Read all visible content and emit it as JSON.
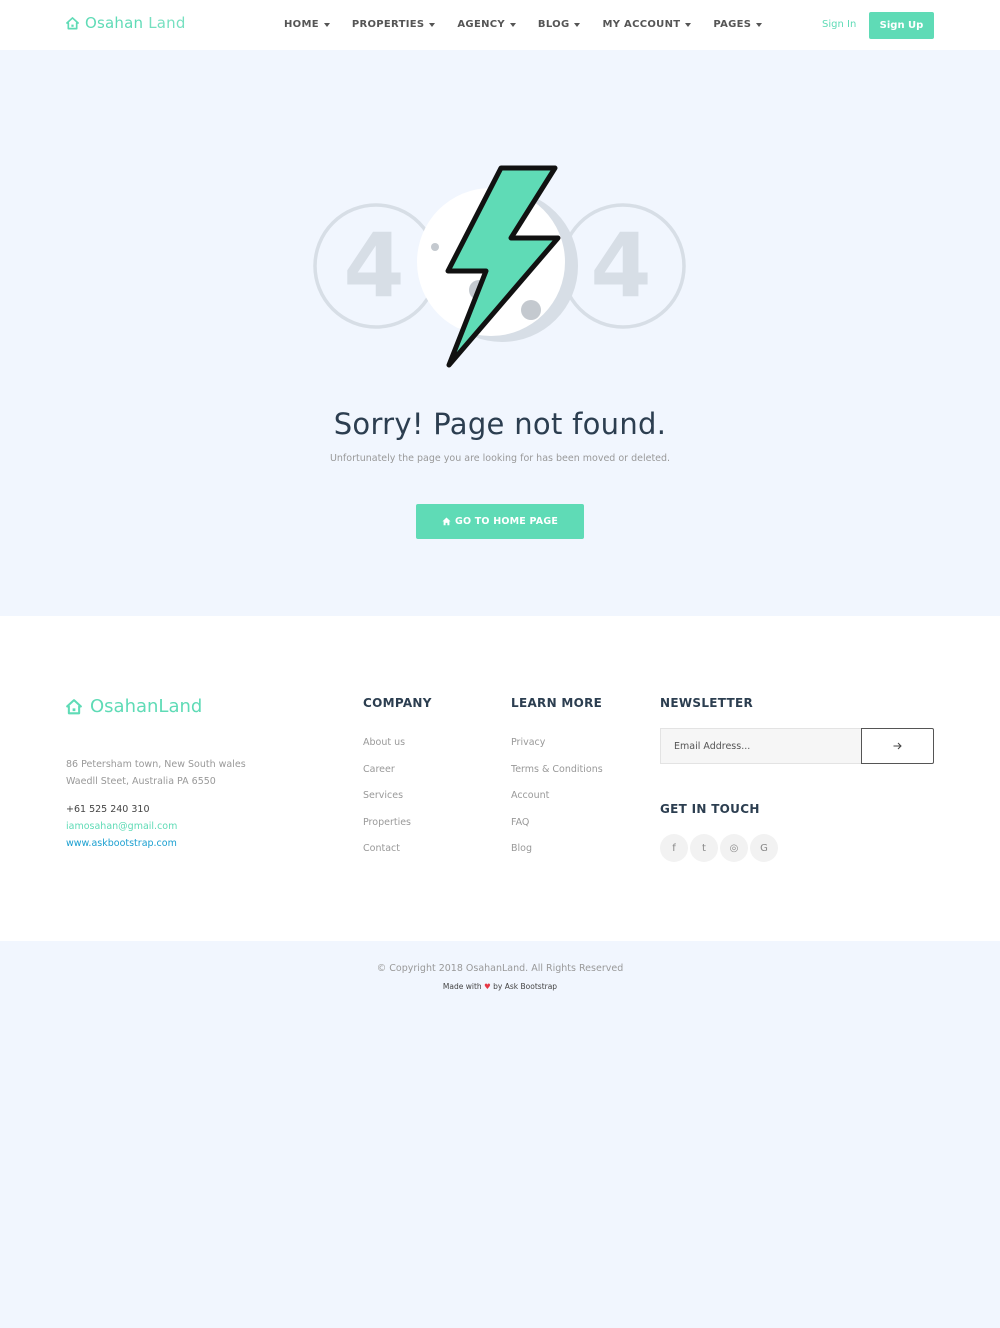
{
  "colors": {
    "accent": "#5fdbb6",
    "text_dark": "#2c3e50",
    "muted": "#999999",
    "link_blue": "#1a9fd0",
    "page_bg": "#f1f6fe",
    "heart": "#e63946"
  },
  "header": {
    "brand_first": "Osahan",
    "brand_second": " Land",
    "brand_icon": "home-icon",
    "nav": [
      {
        "label": "HOME"
      },
      {
        "label": "PROPERTIES"
      },
      {
        "label": "AGENCY"
      },
      {
        "label": "BLOG"
      },
      {
        "label": "MY ACCOUNT"
      },
      {
        "label": "PAGES"
      }
    ],
    "signin": "Sign In",
    "signup": "Sign Up"
  },
  "error": {
    "digits": [
      "4",
      "4"
    ],
    "illustration_icon": "lightning-bolt-icon",
    "title": "Sorry! Page not found.",
    "subtitle": "Unfortunately the page you are looking for has been moved or deleted.",
    "button": "GO TO HOME PAGE",
    "button_icon": "home-icon"
  },
  "footer": {
    "brand": "OsahanLand",
    "address_line1": "86 Petersham town, New South wales",
    "address_line2": "Waedll Steet, Australia PA 6550",
    "phone": "+61 525 240 310",
    "email": "iamosahan@gmail.com",
    "website": "www.askbootstrap.com",
    "company_title": "COMPANY",
    "company_links": [
      "About us",
      "Career",
      "Services",
      "Properties",
      "Contact"
    ],
    "learn_title": "LEARN MORE",
    "learn_links": [
      "Privacy",
      "Terms & Conditions",
      "Account",
      "FAQ",
      "Blog"
    ],
    "newsletter_title": "NEWSLETTER",
    "newsletter_placeholder": "Email Address...",
    "newsletter_button_icon": "arrow-right-icon",
    "touch_title": "GET IN TOUCH",
    "social": [
      {
        "icon": "facebook-icon",
        "glyph": "f"
      },
      {
        "icon": "twitter-icon",
        "glyph": "t"
      },
      {
        "icon": "instagram-icon",
        "glyph": "◎"
      },
      {
        "icon": "google-icon",
        "glyph": "G"
      }
    ]
  },
  "copyright": {
    "text": "© Copyright 2018 OsahanLand. All Rights Reserved",
    "made_prefix": "Made with",
    "made_suffix": "by Ask Bootstrap"
  }
}
